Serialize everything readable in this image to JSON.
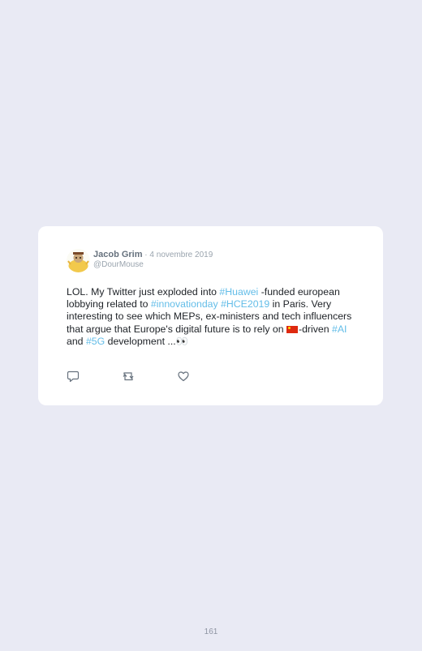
{
  "tweet": {
    "author_name": "Jacob Grim",
    "date_separator": " · ",
    "date": "4 novembre 2019",
    "handle": "@DourMouse",
    "text_parts": [
      {
        "text": "LOL. My Twitter just exploded into ",
        "tag": false
      },
      {
        "text": "#Huawei",
        "tag": true
      },
      {
        "text": " -funded european lobbying related to ",
        "tag": false
      },
      {
        "text": "#innovationday",
        "tag": true
      },
      {
        "text": " ",
        "tag": false
      },
      {
        "text": "#HCE2019",
        "tag": true
      },
      {
        "text": " in Paris. Very interesting to see which MEPs, ex-ministers and tech influencers that argue that Europe's digital future is to rely on ",
        "tag": false
      },
      {
        "text": "-driven ",
        "tag": false
      },
      {
        "text": "#AI",
        "tag": true
      },
      {
        "text": " and ",
        "tag": false
      },
      {
        "text": "#5G",
        "tag": true
      },
      {
        "text": " development ...",
        "tag": false
      },
      {
        "text": "👀",
        "tag": false
      }
    ],
    "actions": [
      {
        "name": "reply-icon",
        "label": "reply"
      },
      {
        "name": "retweet-icon",
        "label": "retweet"
      },
      {
        "name": "like-icon",
        "label": "like"
      }
    ]
  },
  "page_number": "161",
  "colors": {
    "background": "#e9eaf4",
    "card": "#ffffff",
    "hashtag": "#63bde8",
    "name": "#66717d",
    "muted": "#9aa4ae"
  }
}
